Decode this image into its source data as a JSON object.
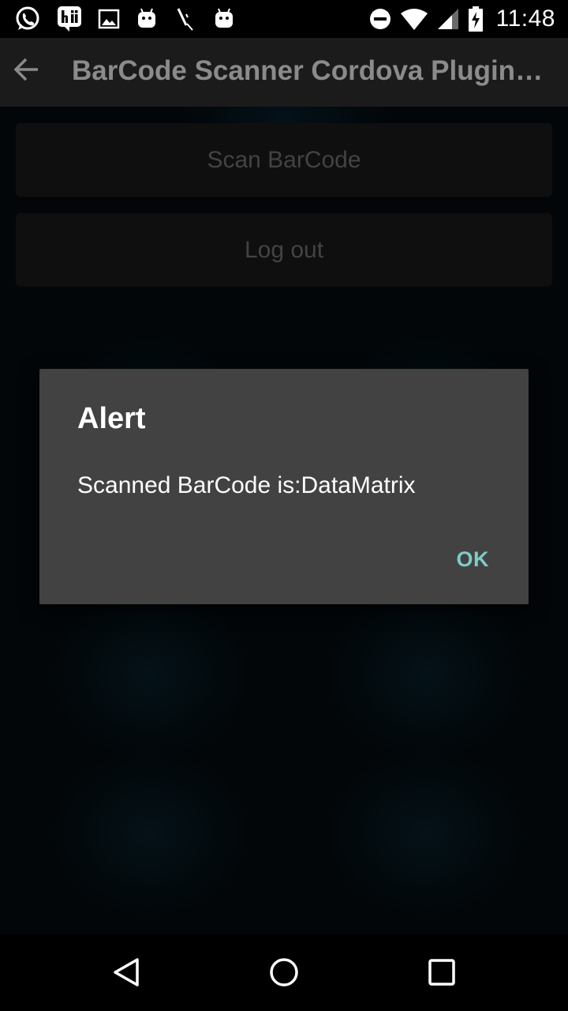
{
  "status_bar": {
    "time": "11:48",
    "left_icons": [
      "whatsapp-icon",
      "hike-icon",
      "gallery-icon",
      "android-debug-icon",
      "pen-icon",
      "android-debug-icon"
    ],
    "right_icons": [
      "do-not-disturb-icon",
      "wifi-icon",
      "cell-signal-icon",
      "battery-charging-icon"
    ]
  },
  "app_bar": {
    "title": "BarCode Scanner Cordova Plugin Demo",
    "back_icon": "arrow-left-icon"
  },
  "main": {
    "scan_button_label": "Scan BarCode",
    "logout_button_label": "Log out"
  },
  "dialog": {
    "title": "Alert",
    "message": "Scanned BarCode is:DataMatrix",
    "ok_label": "OK"
  },
  "nav_bar": {
    "icons": [
      "back-triangle-icon",
      "home-circle-icon",
      "recents-square-icon"
    ]
  },
  "colors": {
    "status_bar_bg": "#000000",
    "app_bar_bg": "#1b1b1b",
    "app_title": "#8b8b8b",
    "button_bg": "#1c1c1d",
    "button_text": "#7a7a7a",
    "dialog_bg": "#424242",
    "dialog_text": "#ffffff",
    "dialog_action": "#80cbc4"
  }
}
